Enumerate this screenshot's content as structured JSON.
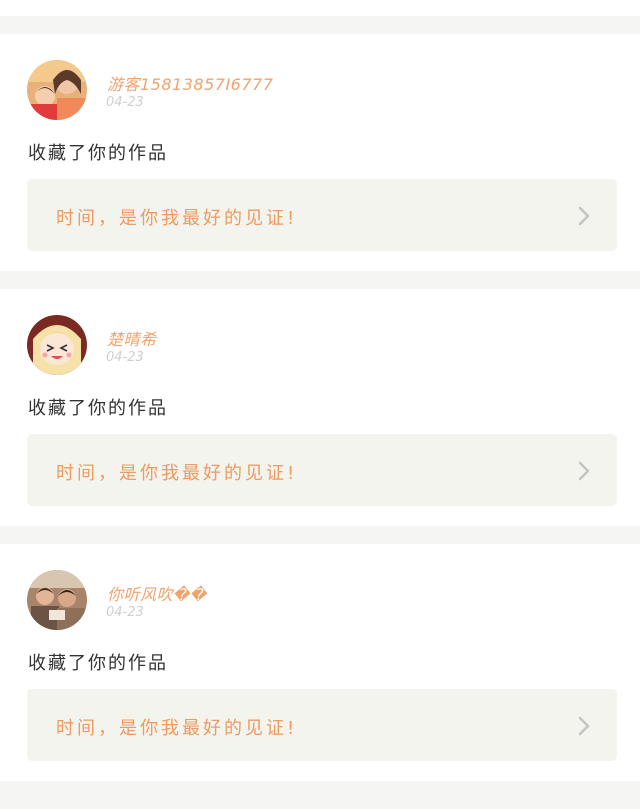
{
  "feed": {
    "items": [
      {
        "username": "游客15813857I6777",
        "date": "04-23",
        "action": "收藏了你的作品",
        "quote": "时间，是你我最好的见证!",
        "avatar_icon": "avatar-photo-mother-child"
      },
      {
        "username": "楚晴希",
        "date": "04-23",
        "action": "收藏了你的作品",
        "quote": "时间，是你我最好的见证!",
        "avatar_icon": "avatar-anime-girl"
      },
      {
        "username": "你听风吹��",
        "date": "04-23",
        "action": "收藏了你的作品",
        "quote": "时间，是你我最好的见证!",
        "avatar_icon": "avatar-photo-group"
      }
    ]
  },
  "colors": {
    "username": "#f0a36d",
    "quote_text": "#ee9a60",
    "quote_bg": "#f4f4ee",
    "page_bg": "#f5f5f3"
  }
}
